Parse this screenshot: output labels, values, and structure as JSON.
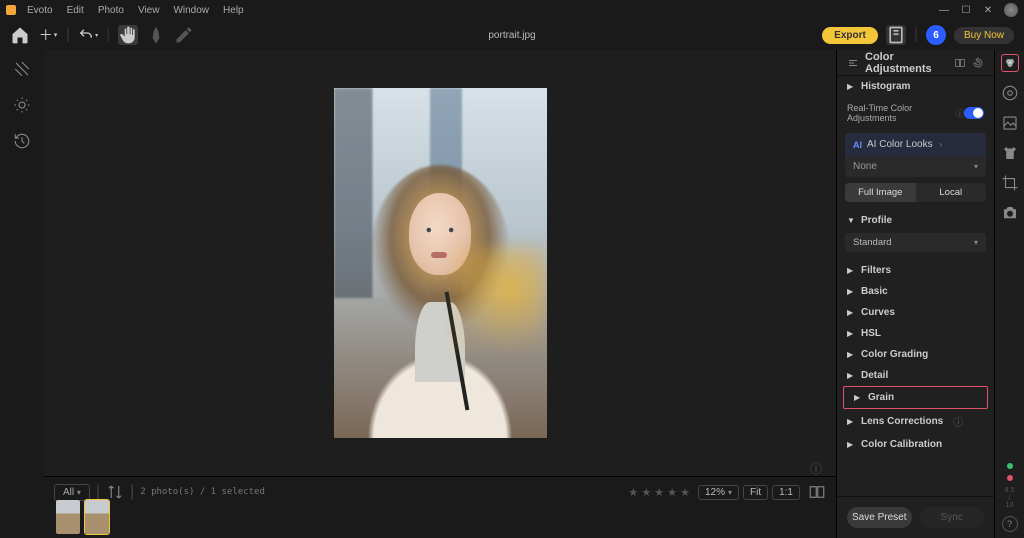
{
  "menu": {
    "items": [
      "Evoto",
      "Edit",
      "Photo",
      "View",
      "Window",
      "Help"
    ]
  },
  "toolbar": {
    "filename": "portrait.jpg",
    "export": "Export",
    "credits": "6",
    "buy": "Buy Now"
  },
  "panel": {
    "title": "Color Adjustments",
    "histogram": "Histogram",
    "realtime": "Real-Time Color Adjustments",
    "ai_looks": "AI Color Looks",
    "ai_value": "None",
    "seg_full": "Full Image",
    "seg_local": "Local",
    "profile": "Profile",
    "profile_value": "Standard",
    "sections": {
      "filters": "Filters",
      "basic": "Basic",
      "curves": "Curves",
      "hsl": "HSL",
      "grading": "Color Grading",
      "detail": "Detail",
      "grain": "Grain",
      "lens": "Lens Corrections",
      "calibration": "Color Calibration"
    },
    "save": "Save Preset",
    "sync": "Sync"
  },
  "filmstrip": {
    "filter": "All",
    "count": "2 photo(s) / 1 selected",
    "zoom": "12%",
    "fit": "Fit",
    "oneone": "1:1"
  },
  "rr": {
    "ratio": "8.5\n/\n10",
    "help": "?"
  }
}
